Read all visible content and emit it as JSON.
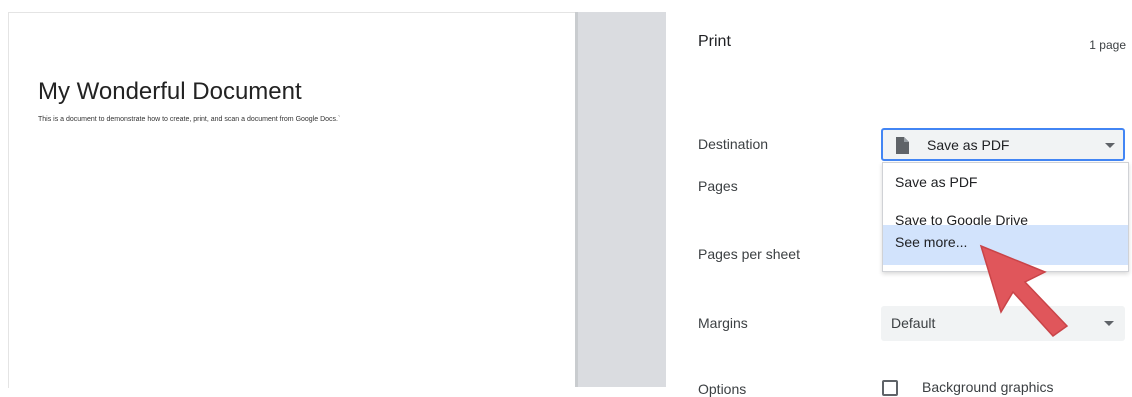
{
  "document": {
    "title": "My Wonderful Document",
    "body": "This is a document to demonstrate how to create, print, and scan a document from Google Docs.`"
  },
  "print_panel": {
    "title": "Print",
    "page_count": "1 page",
    "labels": {
      "destination": "Destination",
      "pages": "Pages",
      "pages_per_sheet": "Pages per sheet",
      "margins": "Margins",
      "options": "Options"
    },
    "destination_select": {
      "value": "Save as PDF",
      "icon": "document-icon"
    },
    "destination_dropdown": [
      {
        "label": "Save as PDF",
        "highlighted": false
      },
      {
        "label": "Save to Google Drive",
        "highlighted": false
      },
      {
        "label": "See more...",
        "highlighted": true
      }
    ],
    "margins_select": {
      "value": "Default"
    },
    "options_checkbox": {
      "label": "Background graphics",
      "checked": false
    }
  },
  "colors": {
    "focus_border": "#4285f4",
    "highlight": "#d2e3fc",
    "cursor_arrow": "#e0565b",
    "gutter": "#dadce0"
  }
}
